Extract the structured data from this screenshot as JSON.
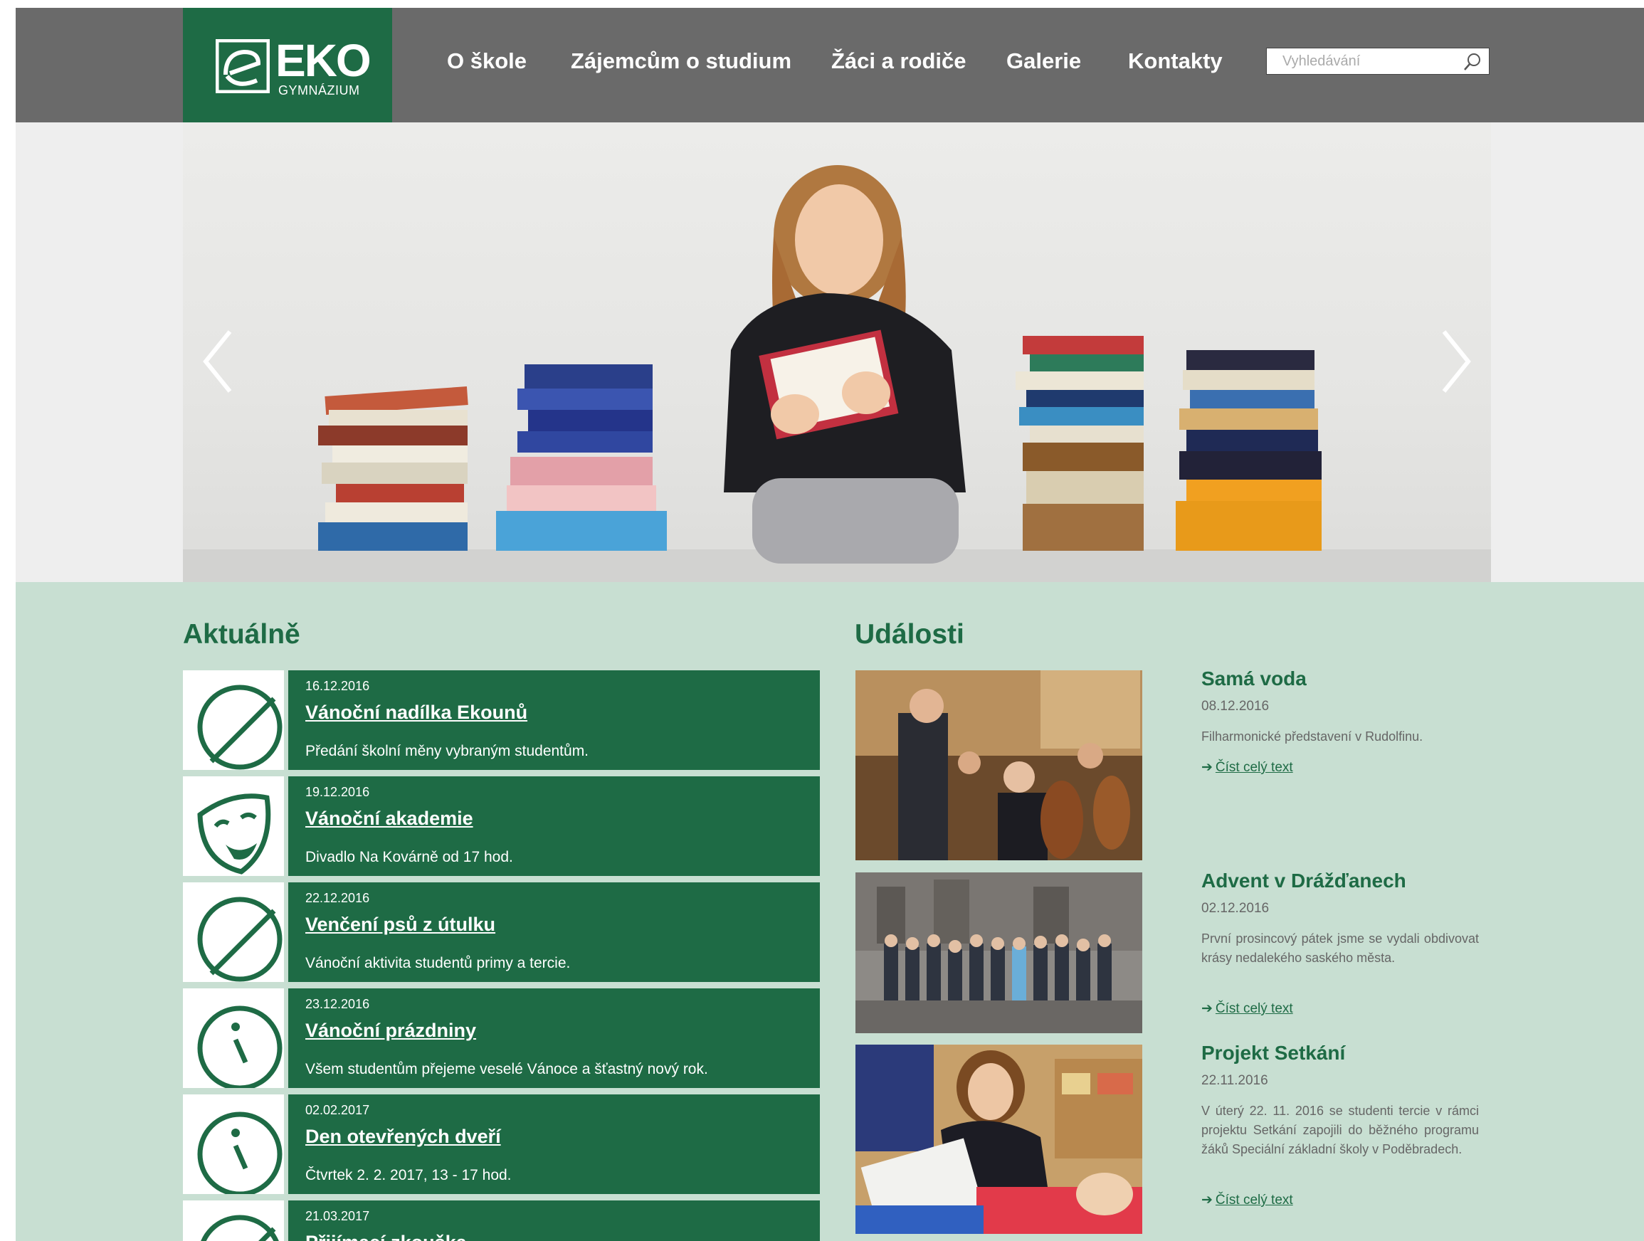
{
  "header": {
    "logo": {
      "brand": "EKO",
      "subtitle": "GYMNÁZIUM"
    },
    "nav": [
      "O škole",
      "Zájemcům o studium",
      "Žáci a rodiče",
      "Galerie",
      "Kontakty"
    ],
    "search": {
      "placeholder": "Vyhledávání"
    }
  },
  "hero": {
    "icons": [
      "slider-prev-icon",
      "slider-next-icon"
    ]
  },
  "news": {
    "title": "Aktuálně",
    "items": [
      {
        "date": "16.12.2016",
        "title": "Vánoční nadílka Ekounů",
        "desc": "Předání školní měny vybraným studentům.",
        "icon": "eko-logo-icon"
      },
      {
        "date": "19.12.2016",
        "title": "Vánoční akademie",
        "desc": "Divadlo Na Kovárně od 17 hod.",
        "icon": "theater-mask-icon"
      },
      {
        "date": "22.12.2016",
        "title": "Venčení psů z útulku",
        "desc": "Vánoční aktivita studentů primy a tercie.",
        "icon": "eko-logo-icon"
      },
      {
        "date": "23.12.2016",
        "title": "Vánoční prázdniny",
        "desc": "Všem studentům přejeme veselé Vánoce a šťastný nový rok.",
        "icon": "info-icon"
      },
      {
        "date": "02.02.2017",
        "title": "Den otevřených dveří",
        "desc": "Čtvrtek 2. 2. 2017, 13 - 17 hod.",
        "icon": "info-icon"
      },
      {
        "date": "21.03.2017",
        "title": "Přijímací zkouška",
        "desc": "",
        "icon": "eko-logo-icon"
      }
    ]
  },
  "events": {
    "title": "Události",
    "read_more": "Číst celý text",
    "items": [
      {
        "title": "Samá voda",
        "date": "08.12.2016",
        "desc": "Filharmonické představení v Rudolfinu."
      },
      {
        "title": "Advent v Drážďanech",
        "date": "02.12.2016",
        "desc": "První prosincový pátek jsme se vydali obdivovat krásy nedalekého saského města."
      },
      {
        "title": "Projekt Setkání",
        "date": "22.11.2016",
        "desc": "V úterý 22. 11. 2016 se studenti tercie v rámci projektu Setkání zapojili do běžného programu žáků Speciální základní školy v Poděbradech."
      }
    ]
  },
  "colors": {
    "brand_green": "#1e6b45",
    "header_gray": "#6a6a6a",
    "content_bg": "#c8dfd2"
  }
}
